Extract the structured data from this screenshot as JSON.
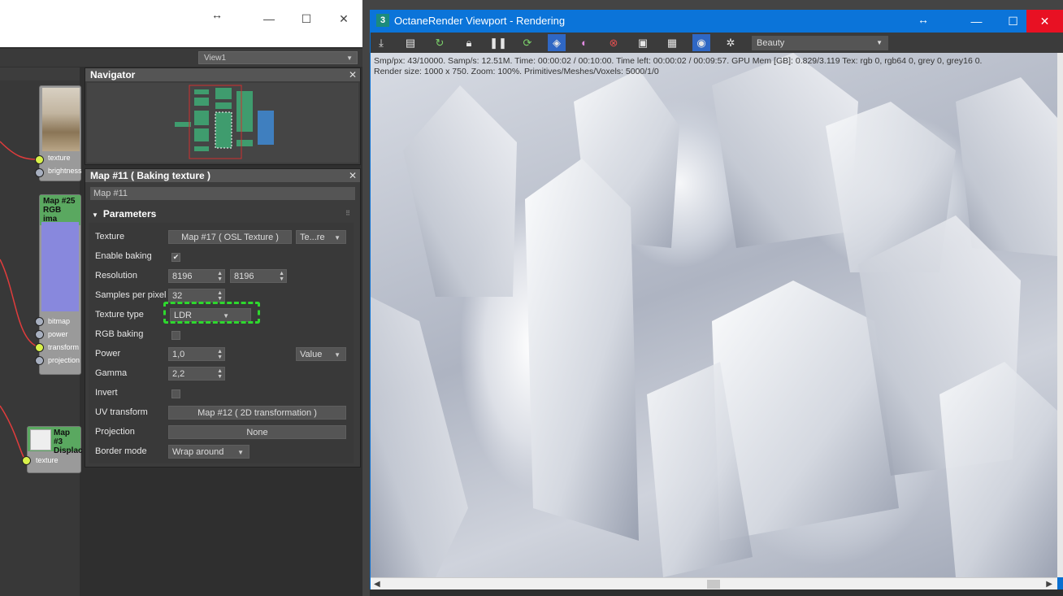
{
  "slate": {
    "view_dropdown": "View1",
    "nodes": {
      "node_top": {
        "inputs": [
          "texture",
          "brightness"
        ]
      },
      "node_rgb": {
        "title_line1": "Map #25",
        "title_line2": "RGB ima",
        "inputs": [
          "bitmap",
          "power",
          "transform",
          "projection"
        ]
      },
      "node_disp": {
        "title_line1": "Map #3",
        "title_line2": "Displac",
        "inputs": [
          "texture"
        ]
      }
    }
  },
  "navigator": {
    "title": "Navigator"
  },
  "map_panel": {
    "title": "Map #11  ( Baking texture )",
    "name_value": "Map #11",
    "parameters_title": "Parameters",
    "rows": {
      "texture": {
        "label": "Texture",
        "value": "Map #17  ( OSL Texture )",
        "mode": "Te...re"
      },
      "enable_baking": {
        "label": "Enable baking",
        "checked": "✔"
      },
      "resolution": {
        "label": "Resolution",
        "w": "8196",
        "h": "8196"
      },
      "spp": {
        "label": "Samples per pixel",
        "value": "32"
      },
      "texture_type": {
        "label": "Texture type",
        "value": "LDR"
      },
      "rgb_baking": {
        "label": "RGB baking"
      },
      "power": {
        "label": "Power",
        "value": "1,0",
        "mode": "Value"
      },
      "gamma": {
        "label": "Gamma",
        "value": "2,2"
      },
      "invert": {
        "label": "Invert"
      },
      "uv_transform": {
        "label": "UV transform",
        "value": "Map #12  ( 2D transformation )"
      },
      "projection": {
        "label": "Projection",
        "value": "None"
      },
      "border_mode": {
        "label": "Border mode",
        "value": "Wrap around"
      }
    }
  },
  "octane": {
    "title": "OctaneRender Viewport - Rendering",
    "logo": "3",
    "pass_dropdown": "Beauty",
    "stats_line1": "Smp/px: 43/10000.   Samp/s: 12.51M.   Time: 00:00:02 / 00:10:00.   Time left: 00:00:02 / 00:09:57.   GPU Mem [GB]: 0.829/3.119   Tex: rgb 0, rgb64 0, grey 0, grey16 0.",
    "stats_line2": "Render size: 1000 x 750.   Zoom: 100%.   Primitives/Meshes/Voxels: 5000/1/0"
  },
  "colors": {
    "socket_yellow": "#d9f24a",
    "socket_gray": "#a8b0c0",
    "wire_red": "#e03c3c",
    "highlight_green": "#2ed82e",
    "node_green": "#5aa860",
    "nav_green": "#3f9c6e",
    "nav_blue": "#3f7fbf",
    "octane_blue": "#0b74d9"
  },
  "icons": {
    "toolbar": [
      "save-render-icon",
      "copy-clipboard-icon",
      "restart-icon",
      "lock-icon",
      "pause-icon",
      "refresh-icon",
      "clay-mode-icon",
      "color-picker-icon",
      "region-icon",
      "film-icon",
      "snapshot-icon",
      "camera-icon",
      "settings-icon"
    ]
  }
}
